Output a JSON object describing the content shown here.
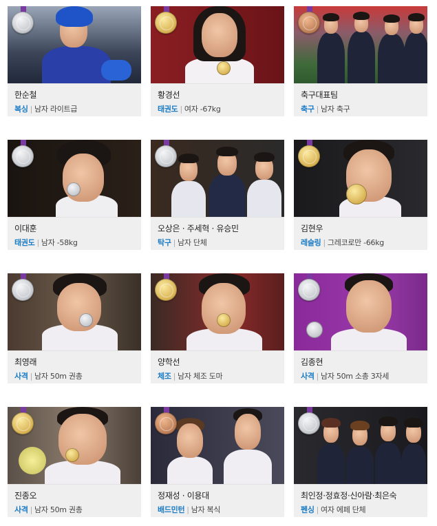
{
  "colors": {
    "silver": "#cfd2d6",
    "gold": "#d9b24a",
    "bronze": "#c98a5e",
    "sport_text": "#1b7bc4",
    "caption_bg": "#efefef"
  },
  "cards": [
    {
      "name": "한순철",
      "sport": "복싱",
      "event": "남자 라이트급",
      "medal": "silver"
    },
    {
      "name": "황경선",
      "sport": "태권도",
      "event": "여자 -67kg",
      "medal": "gold"
    },
    {
      "name": "축구대표팀",
      "sport": "축구",
      "event": "남자 축구",
      "medal": "bronze"
    },
    {
      "name": "이대훈",
      "sport": "태권도",
      "event": "남자 -58kg",
      "medal": "silver"
    },
    {
      "name": "오상은 · 주세혁 · 유승민",
      "sport": "탁구",
      "event": "남자 단체",
      "medal": "silver"
    },
    {
      "name": "김현우",
      "sport": "레슬링",
      "event": "그레코로만 -66kg",
      "medal": "gold"
    },
    {
      "name": "최영래",
      "sport": "사격",
      "event": "남자 50m 권총",
      "medal": "silver"
    },
    {
      "name": "양학선",
      "sport": "체조",
      "event": "남자 체조 도마",
      "medal": "gold"
    },
    {
      "name": "김종현",
      "sport": "사격",
      "event": "남자 50m 소총 3자세",
      "medal": "silver"
    },
    {
      "name": "진종오",
      "sport": "사격",
      "event": "남자 50m 권총",
      "medal": "gold"
    },
    {
      "name": "정재성 · 이용대",
      "sport": "배드민턴",
      "event": "남자 복식",
      "medal": "bronze"
    },
    {
      "name": "최인정·정효정·신아람·최은숙",
      "sport": "펜싱",
      "event": "여자 에페 단체",
      "medal": "silver"
    }
  ]
}
